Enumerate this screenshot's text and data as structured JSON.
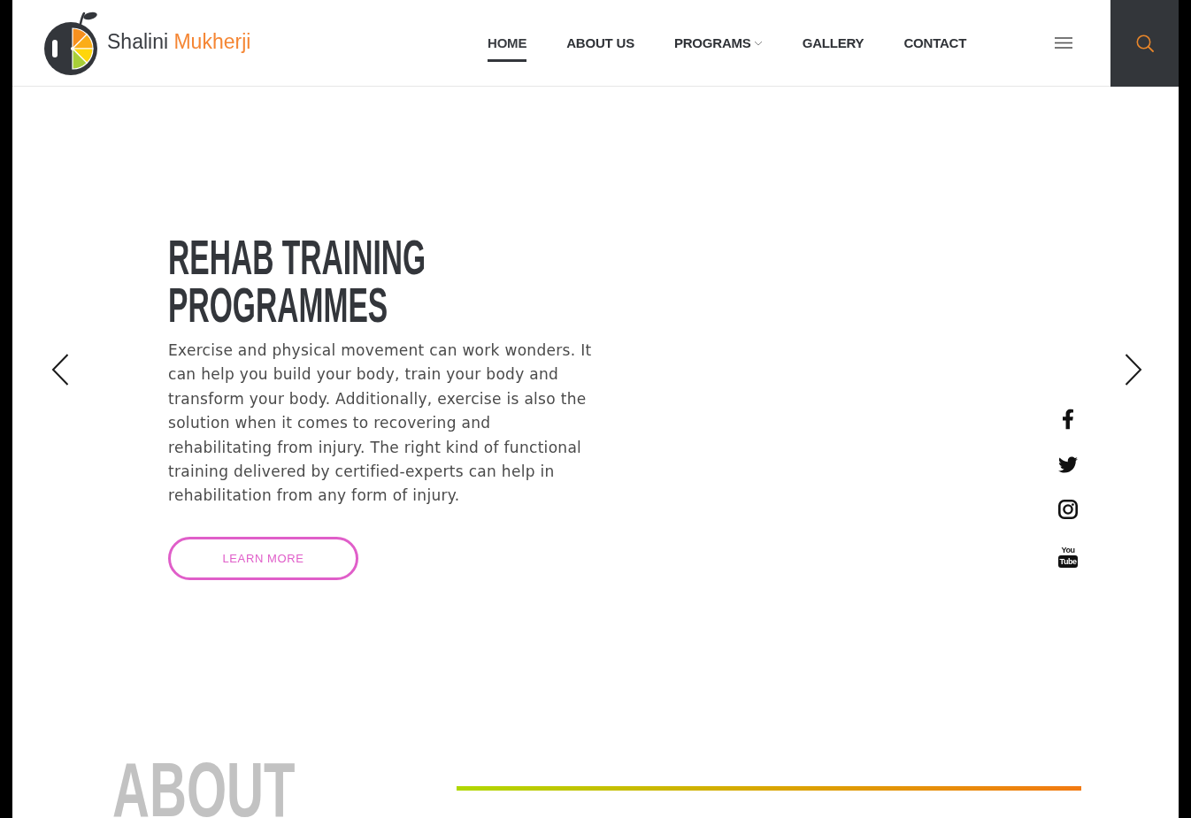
{
  "header": {
    "logo": {
      "first_name": "Shalini",
      "last_name": "Mukherji"
    },
    "nav": [
      {
        "label": "HOME",
        "selected": true,
        "dropdown": false
      },
      {
        "label": "ABOUT US",
        "selected": false,
        "dropdown": false
      },
      {
        "label": "PROGRAMS",
        "selected": false,
        "dropdown": true
      },
      {
        "label": "GALLERY",
        "selected": false,
        "dropdown": false
      },
      {
        "label": "CONTACT",
        "selected": false,
        "dropdown": false
      }
    ]
  },
  "hero": {
    "title": "REHAB TRAINING PROGRAMMES",
    "text": "Exercise and physical movement can work wonders. It can help you build your body, train your body and transform your body. Additionally, exercise is also the solution when it comes to recovering and rehabilitating from injury. The right kind of functional training delivered by certified-experts can help in rehabilitation from any form of injury.",
    "button": "LEARN MORE",
    "youtube_logo": {
      "top": "You",
      "bottom": "Tube"
    }
  },
  "about": {
    "title": "ABOUT"
  }
}
